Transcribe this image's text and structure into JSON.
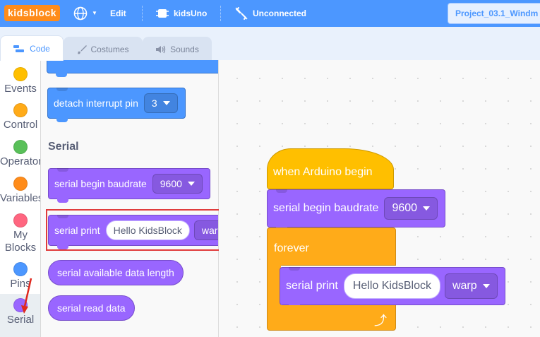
{
  "menubar": {
    "logo": "kidsblock",
    "edit_label": "Edit",
    "device_label": "kidsUno",
    "connection_label": "Unconnected",
    "project_title": "Project_03.1_Windm"
  },
  "tabs": [
    {
      "label": "Code",
      "icon": "code-icon",
      "active": true
    },
    {
      "label": "Costumes",
      "icon": "brush-icon",
      "active": false
    },
    {
      "label": "Sounds",
      "icon": "speaker-icon",
      "active": false
    }
  ],
  "categories": [
    {
      "label": "Events",
      "color": "#ffbf00"
    },
    {
      "label": "Control",
      "color": "#ffab19"
    },
    {
      "label": "Operators",
      "color": "#59c059"
    },
    {
      "label": "Variables",
      "color": "#ff8c1a"
    },
    {
      "label_line1": "My",
      "label_line2": "Blocks",
      "color": "#ff6680"
    },
    {
      "label": "Pins",
      "color": "#4c97ff"
    },
    {
      "label": "Serial",
      "color": "#9966ff"
    }
  ],
  "palette": {
    "detach_label": "detach interrupt pin",
    "detach_value": "3",
    "section_heading": "Serial",
    "begin_label": "serial begin baudrate",
    "begin_value": "9600",
    "print_label": "serial print",
    "print_text": "Hello KidsBlock",
    "print_mode": "warp",
    "available_label": "serial available data length",
    "read_label": "serial read data"
  },
  "workspace": {
    "hat_label": "when Arduino begin",
    "begin_label": "serial begin baudrate",
    "begin_value": "9600",
    "forever_label": "forever",
    "print_label": "serial print",
    "print_text": "Hello KidsBlock",
    "print_mode": "warp"
  },
  "colors": {
    "menubar": "#4c97ff",
    "serial_block": "#9966ff",
    "pins_block": "#4c97ff",
    "events_block": "#ffbf00",
    "control_block": "#ffab19",
    "highlight": "#e03c3c"
  }
}
